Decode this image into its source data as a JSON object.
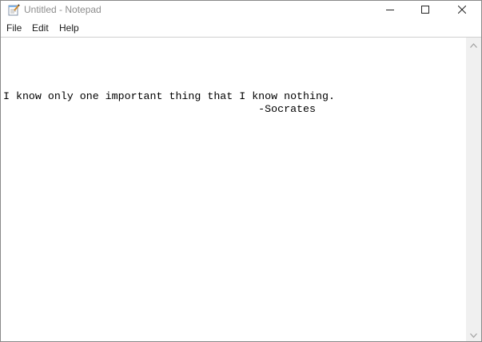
{
  "window": {
    "title": "Untitled - Notepad",
    "controls": {
      "minimize": "minimize",
      "maximize": "maximize",
      "close": "close"
    }
  },
  "menu": {
    "file": "File",
    "edit": "Edit",
    "help": "Help"
  },
  "editor": {
    "lines": [
      "I know only one important thing that I know nothing.",
      "                                        -Socrates"
    ]
  },
  "icons": {
    "app": "notepad-icon",
    "minimize": "minimize-icon",
    "maximize": "maximize-icon",
    "close": "close-icon",
    "scroll_up": "chevron-up-icon",
    "scroll_down": "chevron-down-icon"
  },
  "colors": {
    "title_text": "#8c8c8c",
    "menu_text": "#1a1a1a",
    "editor_bg": "#ffffff",
    "editor_text": "#000000",
    "scrollbar_track": "#f0f0f0",
    "window_border": "#8a8a8a"
  }
}
